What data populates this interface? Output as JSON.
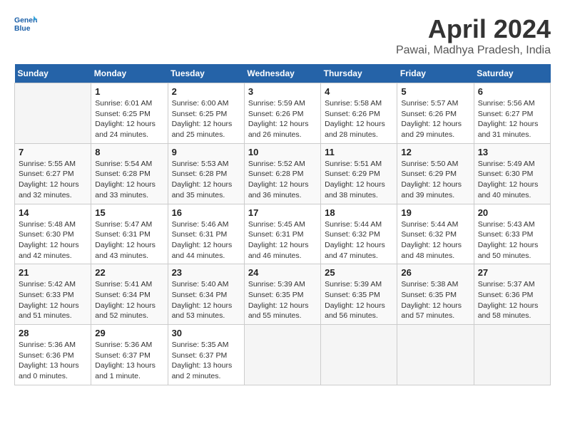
{
  "header": {
    "logo_line1": "General",
    "logo_line2": "Blue",
    "title": "April 2024",
    "subtitle": "Pawai, Madhya Pradesh, India"
  },
  "calendar": {
    "days_of_week": [
      "Sunday",
      "Monday",
      "Tuesday",
      "Wednesday",
      "Thursday",
      "Friday",
      "Saturday"
    ],
    "weeks": [
      [
        {
          "day": "",
          "content": ""
        },
        {
          "day": "1",
          "content": "Sunrise: 6:01 AM\nSunset: 6:25 PM\nDaylight: 12 hours\nand 24 minutes."
        },
        {
          "day": "2",
          "content": "Sunrise: 6:00 AM\nSunset: 6:25 PM\nDaylight: 12 hours\nand 25 minutes."
        },
        {
          "day": "3",
          "content": "Sunrise: 5:59 AM\nSunset: 6:26 PM\nDaylight: 12 hours\nand 26 minutes."
        },
        {
          "day": "4",
          "content": "Sunrise: 5:58 AM\nSunset: 6:26 PM\nDaylight: 12 hours\nand 28 minutes."
        },
        {
          "day": "5",
          "content": "Sunrise: 5:57 AM\nSunset: 6:26 PM\nDaylight: 12 hours\nand 29 minutes."
        },
        {
          "day": "6",
          "content": "Sunrise: 5:56 AM\nSunset: 6:27 PM\nDaylight: 12 hours\nand 31 minutes."
        }
      ],
      [
        {
          "day": "7",
          "content": "Sunrise: 5:55 AM\nSunset: 6:27 PM\nDaylight: 12 hours\nand 32 minutes."
        },
        {
          "day": "8",
          "content": "Sunrise: 5:54 AM\nSunset: 6:28 PM\nDaylight: 12 hours\nand 33 minutes."
        },
        {
          "day": "9",
          "content": "Sunrise: 5:53 AM\nSunset: 6:28 PM\nDaylight: 12 hours\nand 35 minutes."
        },
        {
          "day": "10",
          "content": "Sunrise: 5:52 AM\nSunset: 6:28 PM\nDaylight: 12 hours\nand 36 minutes."
        },
        {
          "day": "11",
          "content": "Sunrise: 5:51 AM\nSunset: 6:29 PM\nDaylight: 12 hours\nand 38 minutes."
        },
        {
          "day": "12",
          "content": "Sunrise: 5:50 AM\nSunset: 6:29 PM\nDaylight: 12 hours\nand 39 minutes."
        },
        {
          "day": "13",
          "content": "Sunrise: 5:49 AM\nSunset: 6:30 PM\nDaylight: 12 hours\nand 40 minutes."
        }
      ],
      [
        {
          "day": "14",
          "content": "Sunrise: 5:48 AM\nSunset: 6:30 PM\nDaylight: 12 hours\nand 42 minutes."
        },
        {
          "day": "15",
          "content": "Sunrise: 5:47 AM\nSunset: 6:31 PM\nDaylight: 12 hours\nand 43 minutes."
        },
        {
          "day": "16",
          "content": "Sunrise: 5:46 AM\nSunset: 6:31 PM\nDaylight: 12 hours\nand 44 minutes."
        },
        {
          "day": "17",
          "content": "Sunrise: 5:45 AM\nSunset: 6:31 PM\nDaylight: 12 hours\nand 46 minutes."
        },
        {
          "day": "18",
          "content": "Sunrise: 5:44 AM\nSunset: 6:32 PM\nDaylight: 12 hours\nand 47 minutes."
        },
        {
          "day": "19",
          "content": "Sunrise: 5:44 AM\nSunset: 6:32 PM\nDaylight: 12 hours\nand 48 minutes."
        },
        {
          "day": "20",
          "content": "Sunrise: 5:43 AM\nSunset: 6:33 PM\nDaylight: 12 hours\nand 50 minutes."
        }
      ],
      [
        {
          "day": "21",
          "content": "Sunrise: 5:42 AM\nSunset: 6:33 PM\nDaylight: 12 hours\nand 51 minutes."
        },
        {
          "day": "22",
          "content": "Sunrise: 5:41 AM\nSunset: 6:34 PM\nDaylight: 12 hours\nand 52 minutes."
        },
        {
          "day": "23",
          "content": "Sunrise: 5:40 AM\nSunset: 6:34 PM\nDaylight: 12 hours\nand 53 minutes."
        },
        {
          "day": "24",
          "content": "Sunrise: 5:39 AM\nSunset: 6:35 PM\nDaylight: 12 hours\nand 55 minutes."
        },
        {
          "day": "25",
          "content": "Sunrise: 5:39 AM\nSunset: 6:35 PM\nDaylight: 12 hours\nand 56 minutes."
        },
        {
          "day": "26",
          "content": "Sunrise: 5:38 AM\nSunset: 6:35 PM\nDaylight: 12 hours\nand 57 minutes."
        },
        {
          "day": "27",
          "content": "Sunrise: 5:37 AM\nSunset: 6:36 PM\nDaylight: 12 hours\nand 58 minutes."
        }
      ],
      [
        {
          "day": "28",
          "content": "Sunrise: 5:36 AM\nSunset: 6:36 PM\nDaylight: 13 hours\nand 0 minutes."
        },
        {
          "day": "29",
          "content": "Sunrise: 5:36 AM\nSunset: 6:37 PM\nDaylight: 13 hours\nand 1 minute."
        },
        {
          "day": "30",
          "content": "Sunrise: 5:35 AM\nSunset: 6:37 PM\nDaylight: 13 hours\nand 2 minutes."
        },
        {
          "day": "",
          "content": ""
        },
        {
          "day": "",
          "content": ""
        },
        {
          "day": "",
          "content": ""
        },
        {
          "day": "",
          "content": ""
        }
      ]
    ]
  }
}
